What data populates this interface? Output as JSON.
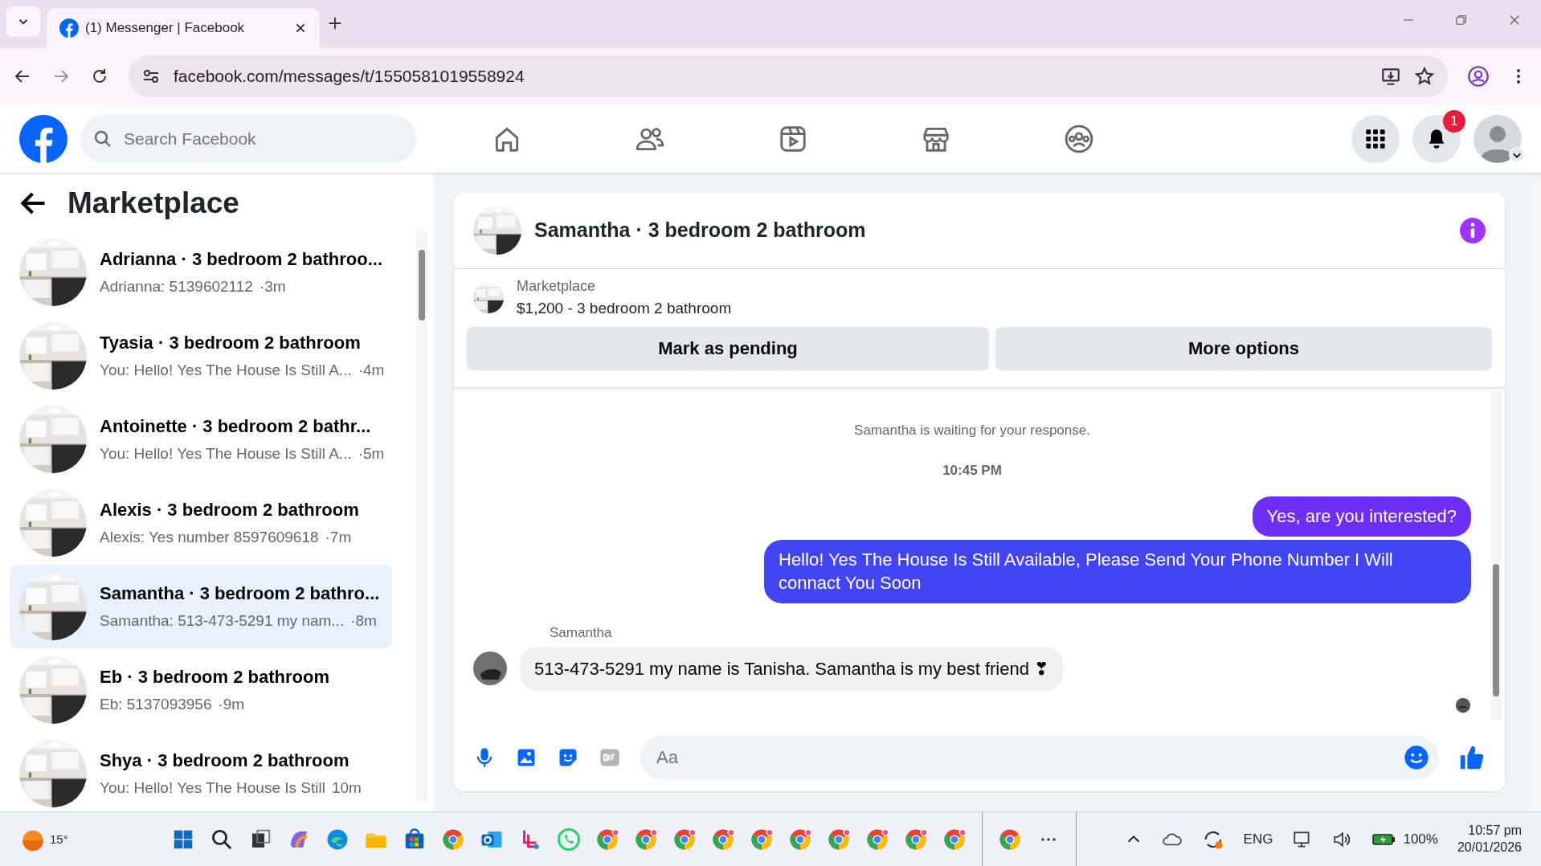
{
  "browser": {
    "tab_title": "(1) Messenger | Facebook",
    "url": "facebook.com/messages/t/1550581019558924"
  },
  "header": {
    "search_placeholder": "Search Facebook",
    "notification_count": "1"
  },
  "sidebar": {
    "title": "Marketplace",
    "conversations": [
      {
        "title": "Adrianna · 3 bedroom 2 bathroo...",
        "preview": "Adrianna: 5139602112",
        "time": "·3m",
        "selected": false
      },
      {
        "title": "Tyasia · 3 bedroom 2 bathroom",
        "preview": "You: Hello! Yes The House Is Still A...",
        "time": "·4m",
        "selected": false
      },
      {
        "title": "Antoinette · 3 bedroom 2 bathr...",
        "preview": "You: Hello! Yes The House Is Still A...",
        "time": "·5m",
        "selected": false
      },
      {
        "title": "Alexis · 3 bedroom 2 bathroom",
        "preview": "Alexis: Yes number 8597609618",
        "time": "·7m",
        "selected": false
      },
      {
        "title": "Samantha · 3 bedroom 2 bathro...",
        "preview": "Samantha: 513-473-5291 my nam...",
        "time": "·8m",
        "selected": true
      },
      {
        "title": "Eb · 3 bedroom 2 bathroom",
        "preview": "Eb: 5137093956",
        "time": "·9m",
        "selected": false
      },
      {
        "title": "Shya · 3 bedroom 2 bathroom",
        "preview": "You: Hello! Yes The House Is Still",
        "time": "10m",
        "selected": false
      }
    ]
  },
  "chat": {
    "title": "Samantha · 3 bedroom 2 bathroom",
    "listing_label": "Marketplace",
    "listing": "$1,200 - 3 bedroom 2 bathroom",
    "buttons": [
      "Mark as pending",
      "More options"
    ],
    "notice": "Samantha is waiting for your response.",
    "timestamp": "10:45 PM",
    "messages": [
      {
        "kind": "sent",
        "text": "Yes, are you interested?",
        "color": "#6d2ff6"
      },
      {
        "kind": "sent",
        "text": "Hello! Yes The House  Is Still Available, Please Send Your Phone Number I Will connact You Soon",
        "color": "#4345f5"
      },
      {
        "kind": "received",
        "sender": "Samantha",
        "text": "513-473-5291 my name is Tanisha. Samantha is my best friend ❣"
      }
    ],
    "composer_placeholder": "Aa"
  },
  "taskbar": {
    "weather": "15°",
    "language": "ENG",
    "battery": "100%",
    "time": "10:57 pm",
    "date": "20/01/2026"
  }
}
